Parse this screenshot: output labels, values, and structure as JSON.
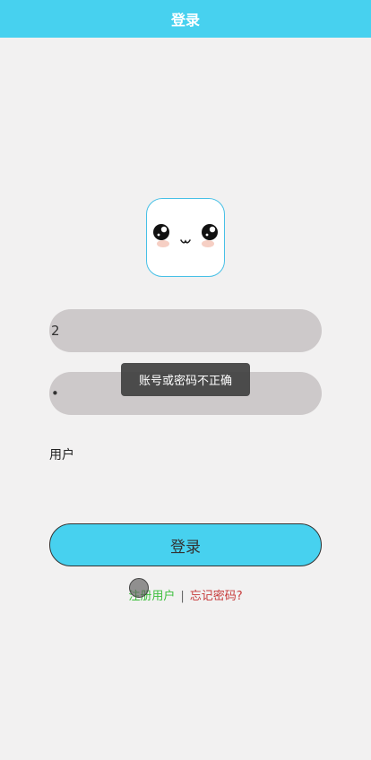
{
  "header": {
    "title": "登录"
  },
  "avatar": {
    "icon": "cute-face-icon"
  },
  "form": {
    "username_value": "2",
    "password_value": "•",
    "role_label": "用户"
  },
  "toast": {
    "message": "账号或密码不正确"
  },
  "login_button": {
    "label": "登录"
  },
  "links": {
    "register": "注册用户",
    "separator": "|",
    "forgot": "忘记密码?"
  },
  "colors": {
    "accent": "#47d1ef",
    "background": "#f2f1f1",
    "field": "#cdc9ca",
    "register_link": "#3cbf3c",
    "forgot_link": "#c63a3a"
  }
}
